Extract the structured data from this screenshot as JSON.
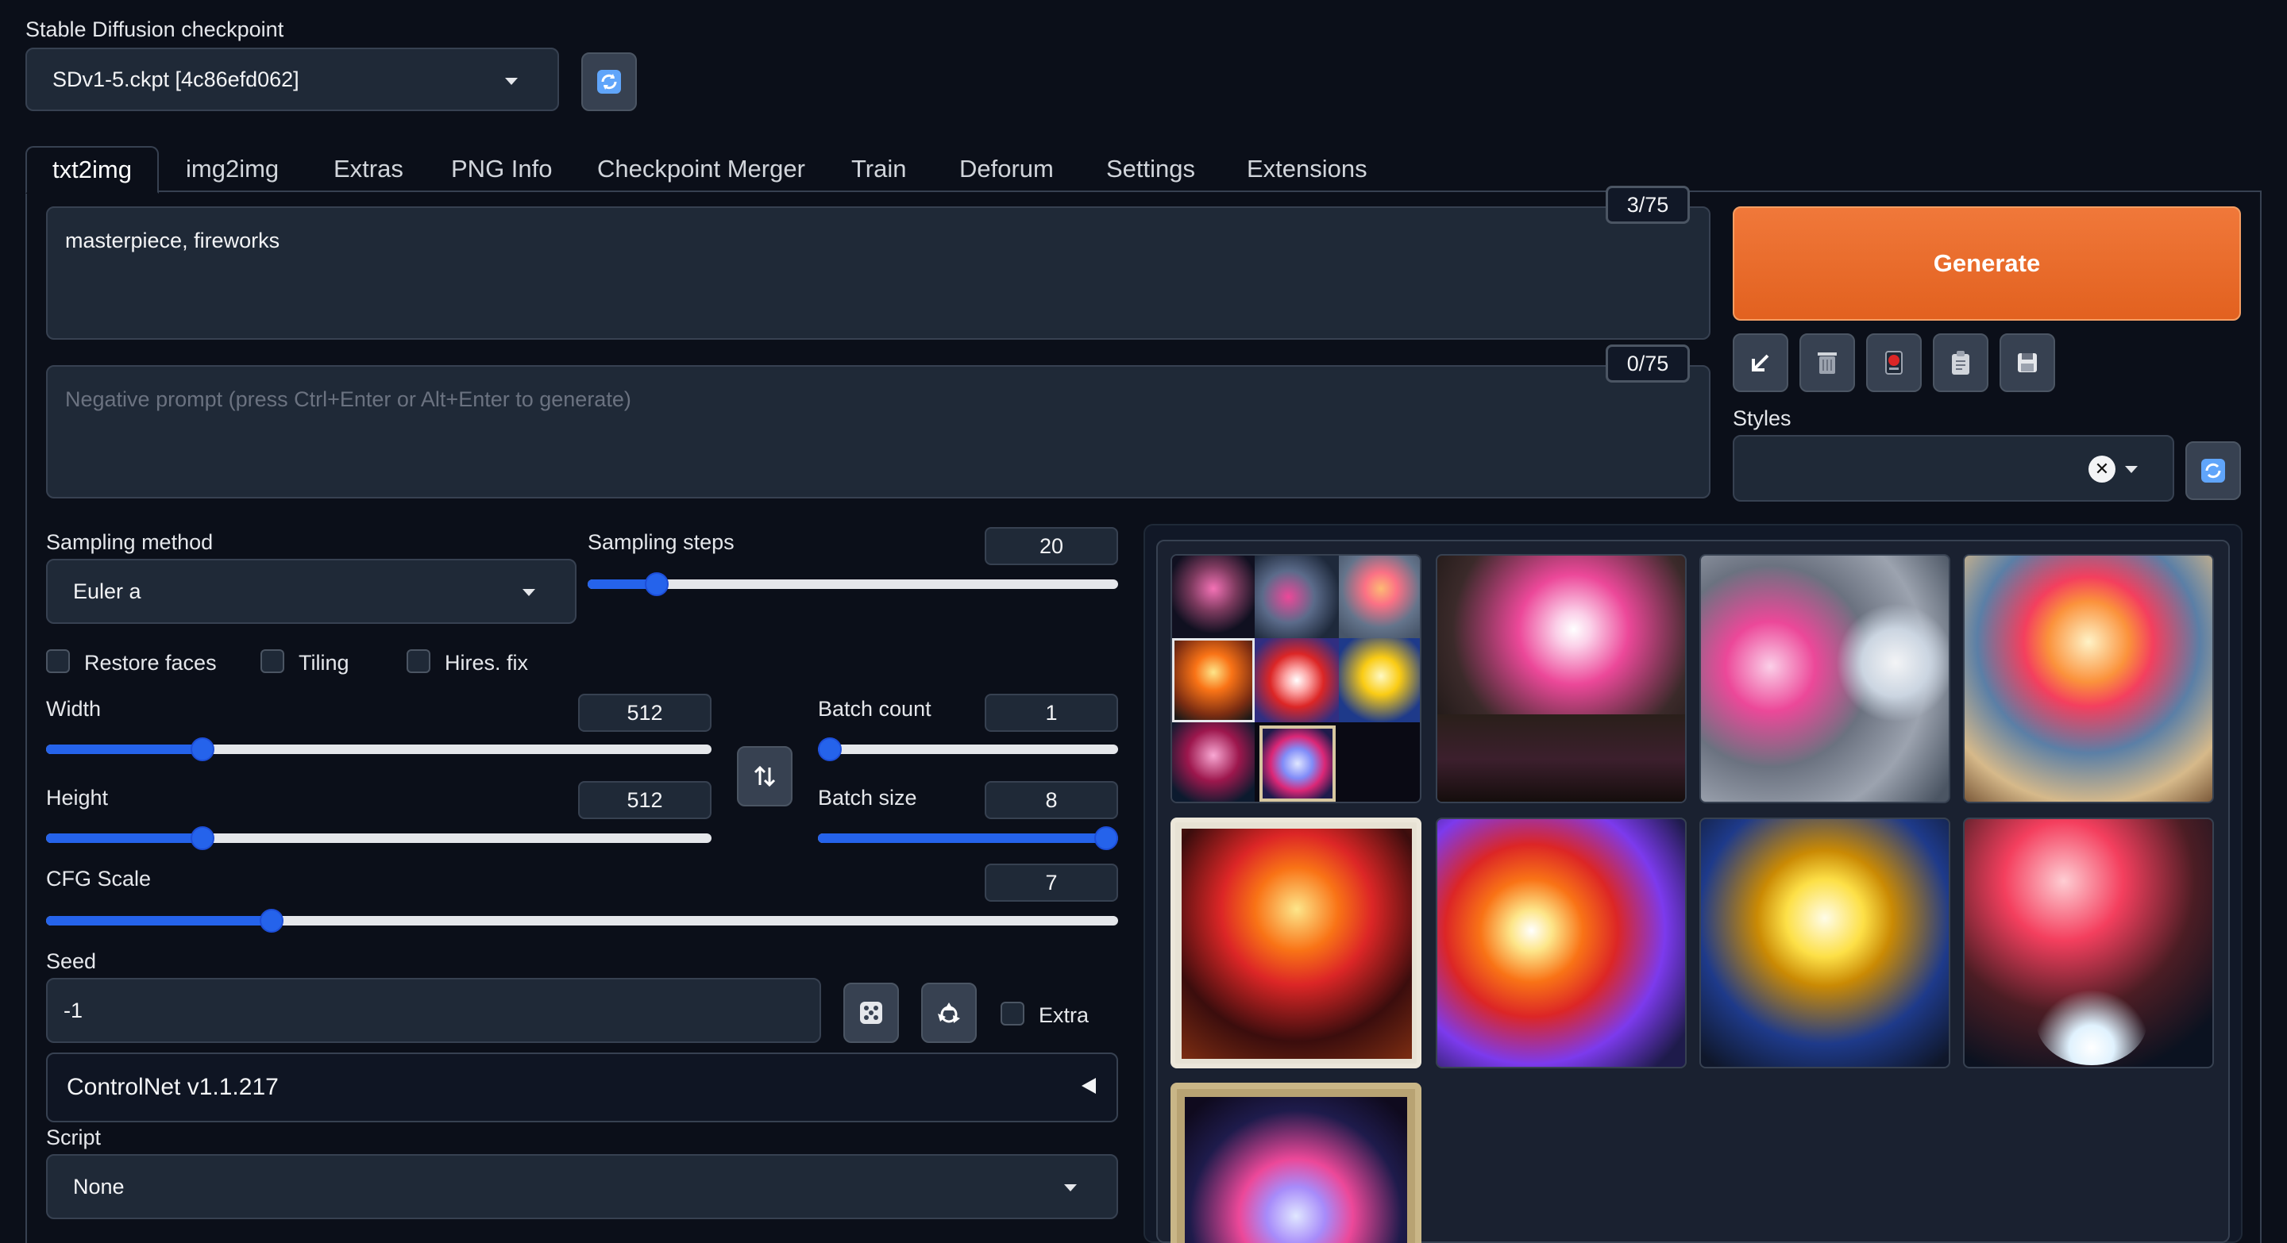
{
  "checkpoint": {
    "label": "Stable Diffusion checkpoint",
    "value": "SDv1-5.ckpt [4c86efd062]"
  },
  "tabs": [
    "txt2img",
    "img2img",
    "Extras",
    "PNG Info",
    "Checkpoint Merger",
    "Train",
    "Deforum",
    "Settings",
    "Extensions"
  ],
  "prompt": {
    "value": "masterpiece, fireworks",
    "token_count": "3/75"
  },
  "negative_prompt": {
    "placeholder": "Negative prompt (press Ctrl+Enter or Alt+Enter to generate)",
    "token_count": "0/75"
  },
  "generate": {
    "label": "Generate"
  },
  "styles": {
    "label": "Styles"
  },
  "sampling_method": {
    "label": "Sampling method",
    "value": "Euler a"
  },
  "sampling_steps": {
    "label": "Sampling steps",
    "value": "20",
    "fraction": 0.13
  },
  "checkboxes": {
    "restore_faces": "Restore faces",
    "tiling": "Tiling",
    "hires_fix": "Hires. fix",
    "extra": "Extra"
  },
  "width": {
    "label": "Width",
    "value": "512",
    "fraction": 0.235
  },
  "height": {
    "label": "Height",
    "value": "512",
    "fraction": 0.235
  },
  "batch_count": {
    "label": "Batch count",
    "value": "1",
    "fraction": 0.0
  },
  "batch_size": {
    "label": "Batch size",
    "value": "8",
    "fraction": 1.0
  },
  "cfg_scale": {
    "label": "CFG Scale",
    "value": "7",
    "fraction": 0.21
  },
  "seed": {
    "label": "Seed",
    "value": "-1"
  },
  "controlnet": {
    "label": "ControlNet v1.1.217"
  },
  "script": {
    "label": "Script",
    "value": "None"
  },
  "colors": {
    "background": "#0b0f19",
    "accent": "#2563eb",
    "generate": "#ea6a2a"
  }
}
